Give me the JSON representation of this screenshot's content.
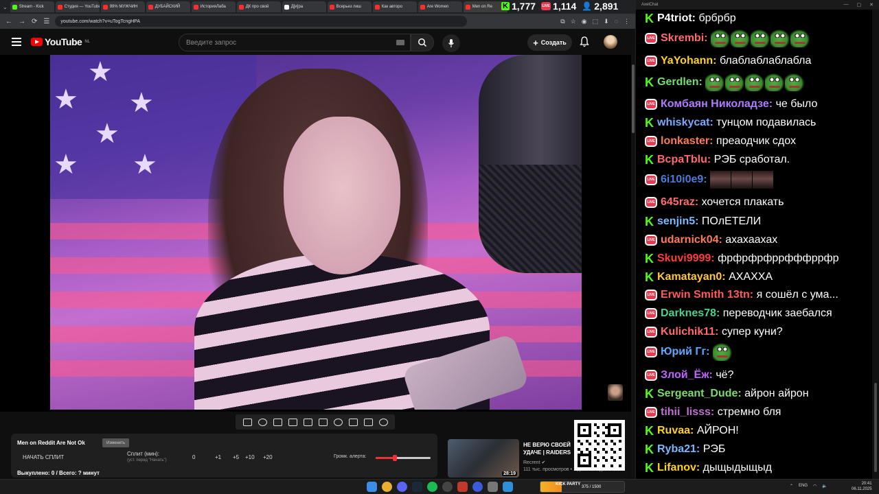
{
  "browser": {
    "tabs": [
      {
        "label": "Stream - Kick",
        "color": "#53fc18"
      },
      {
        "label": "Студия — YouTube",
        "color": "#ff2d2d"
      },
      {
        "label": "99% МУЖЧИН",
        "color": "#ff2d2d"
      },
      {
        "label": "ДУБАЙСКИЙ",
        "color": "#ff2d2d"
      },
      {
        "label": "ИсторияЛаба",
        "color": "#ff2d2d"
      },
      {
        "label": "ДК про свой",
        "color": "#ff2d2d"
      },
      {
        "label": "Д[и]ра",
        "color": "#ffffff"
      },
      {
        "label": "Всерьез лиш",
        "color": "#ff2d2d"
      },
      {
        "label": "Как авторо",
        "color": "#ff2d2d"
      },
      {
        "label": "Are Women",
        "color": "#ff2d2d"
      },
      {
        "label": "Men on Re",
        "color": "#ff2d2d"
      }
    ],
    "url": "youtube.com/watch?v=uTogTcngHPA"
  },
  "counters": {
    "kick": "1,777",
    "live": "1,114",
    "viewers": "2,891"
  },
  "youtube": {
    "logo_text": "YouTube",
    "region": "NL",
    "search_placeholder": "Введите запрос",
    "create_label": "Создать"
  },
  "split_panel": {
    "title": "Men on Reddit Are Not Ok",
    "edit_label": "Изменить",
    "start_label": "НАЧАТЬ СПЛИТ",
    "split_label": "Сплит (мин):",
    "split_hint": "(уст. перед \"Начать\")",
    "split_value": "0",
    "increments": [
      "+1",
      "+5",
      "+10",
      "+20"
    ],
    "alert_volume_label": "Громк. алерта:",
    "alert_volume_level": 0.35,
    "bought_label": "Выкуплено: 0 / Всего: ? минут"
  },
  "recommendation": {
    "title": "НЕ ВЕРЮ СВОЕЙ УДАЧЕ | RAIDERS",
    "channel": "Recrent",
    "meta": "111 тыс. просмотров • 1 день назад",
    "duration": "28:19"
  },
  "chat": {
    "window_title": "AxelChat",
    "messages": [
      {
        "platform": "kick",
        "user": "P4triot",
        "color": "#ffffff",
        "text": "брбрбр",
        "emotes": []
      },
      {
        "platform": "live",
        "user": "Skrembi",
        "color": "#ff6b6b",
        "text": "",
        "emotes": [
          "pepe",
          "pepe",
          "pepe",
          "pepe",
          "pepe"
        ]
      },
      {
        "platform": "live",
        "user": "YaYohann",
        "color": "#ffd21f",
        "text": "блаблаблаблабла",
        "emotes": []
      },
      {
        "platform": "kick",
        "user": "Gerdlen",
        "color": "#6fe06f",
        "text": "",
        "emotes": [
          "pepe",
          "pepe",
          "pepe",
          "pepe",
          "pepe"
        ]
      },
      {
        "platform": "live",
        "user": "Комбаян Николадзе",
        "color": "#b07cff",
        "text": "че было",
        "emotes": []
      },
      {
        "platform": "kick",
        "user": "whiskycat",
        "color": "#7aa9ff",
        "text": "тунцом подавилась",
        "emotes": []
      },
      {
        "platform": "live",
        "user": "lonkaster",
        "color": "#ff7b52",
        "text": "преаодчик сдох",
        "emotes": []
      },
      {
        "platform": "kick",
        "user": "BcpaTblu",
        "color": "#ff6b6b",
        "text": "РЭБ сработал.",
        "emotes": []
      },
      {
        "platform": "live",
        "user": "6i10i0e9",
        "color": "#4a7bd6",
        "text": "",
        "emotes": [
          "dark",
          "dark",
          "dark"
        ]
      },
      {
        "platform": "live",
        "user": "645raz",
        "color": "#ff6b6b",
        "text": "хочется плакать",
        "emotes": []
      },
      {
        "platform": "kick",
        "user": "senjin5",
        "color": "#7ab8ff",
        "text": "ПОлЕТЕЛИ",
        "emotes": []
      },
      {
        "platform": "live",
        "user": "udarnick04",
        "color": "#ff7b52",
        "text": "ахахаахах",
        "emotes": []
      },
      {
        "platform": "kick",
        "user": "Skuvi9999",
        "color": "#ff3b3b",
        "text": "фрфрфрфррфффррфр",
        "emotes": []
      },
      {
        "platform": "kick",
        "user": "Kamatayan0",
        "color": "#ffc83a",
        "text": "АХАХХА",
        "emotes": []
      },
      {
        "platform": "live",
        "user": "Erwin Smith 13tn",
        "color": "#ff5a5a",
        "text": "я сошёл с ума...",
        "emotes": []
      },
      {
        "platform": "live",
        "user": "Darknes78",
        "color": "#4cd18a",
        "text": "переводчик заебался",
        "emotes": []
      },
      {
        "platform": "live",
        "user": "Kulichik11",
        "color": "#ff6b6b",
        "text": "супер куни?",
        "emotes": []
      },
      {
        "platform": "live",
        "user": "Юрий Гг",
        "color": "#5aa8ff",
        "text": "",
        "emotes": [
          "pepe"
        ]
      },
      {
        "platform": "live",
        "user": "Злой_Ёж",
        "color": "#c064ff",
        "text": "чё?",
        "emotes": []
      },
      {
        "platform": "kick",
        "user": "Sergeant_Dude",
        "color": "#7bdc6a",
        "text": "айрон айрон",
        "emotes": []
      },
      {
        "platform": "live",
        "user": "tihii_lisss",
        "color": "#c070d0",
        "text": "стремно бля",
        "emotes": []
      },
      {
        "platform": "kick",
        "user": "Ruvaa",
        "color": "#ffd21f",
        "text": "АЙРОН!",
        "emotes": []
      },
      {
        "platform": "kick",
        "user": "Ryba21",
        "color": "#7ab8ff",
        "text": "РЭБ",
        "emotes": []
      },
      {
        "platform": "kick",
        "user": "Lifanov",
        "color": "#ffd21f",
        "text": "дыщыдыщыд",
        "emotes": []
      }
    ]
  },
  "taskbar": {
    "kick_goal_label": "KICK PARTY",
    "kick_goal_value": "375 / 1500",
    "kick_goal_progress": 0.25,
    "lang": "ENG",
    "time": "20:41",
    "date": "06.11.2025"
  },
  "colors": {
    "kick_green": "#53fc18",
    "live_red": "#e53b51",
    "yt_red": "#ff0000"
  }
}
